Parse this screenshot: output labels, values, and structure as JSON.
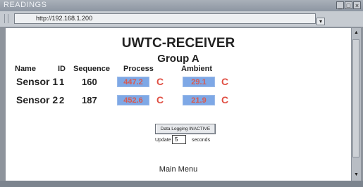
{
  "window": {
    "title": "READINGS",
    "controls": [
      "_",
      "□",
      "×"
    ]
  },
  "address": {
    "url": "http://192.168.1.200",
    "dropdown_icon": "▾"
  },
  "page": {
    "title": "UWTC-RECEIVER",
    "group": "Group A",
    "columns": {
      "name": "Name",
      "id": "ID",
      "sequence": "Sequence",
      "process": "Process",
      "ambient": "Ambient"
    },
    "rows": [
      {
        "name": "Sensor 1",
        "id": "1",
        "sequence": "160",
        "process": "447.2",
        "process_unit": "C",
        "ambient": "29.1",
        "ambient_unit": "C"
      },
      {
        "name": "Sensor 2",
        "id": "2",
        "sequence": "187",
        "process": "452.6",
        "process_unit": "C",
        "ambient": "21.9",
        "ambient_unit": "C"
      }
    ],
    "logging_button": "Data Logging INACTIVE",
    "update": {
      "label": "Update",
      "value": "5",
      "unit": "seconds"
    },
    "main_menu": "Main Menu"
  },
  "colors": {
    "lcd_bg": "#7ea8e6",
    "lcd_text": "#d85a50",
    "unit": "#e04f43"
  }
}
